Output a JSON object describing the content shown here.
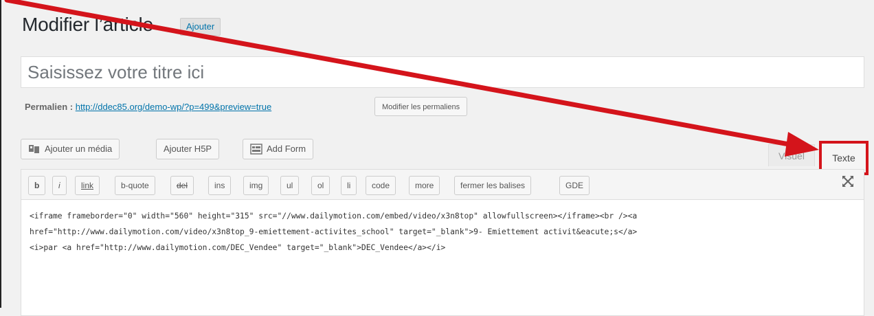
{
  "header": {
    "title": "Modifier l’article",
    "add_new_label": "Ajouter"
  },
  "post_title": {
    "placeholder": "Saisissez votre titre ici"
  },
  "permalink": {
    "label": "Permalien :",
    "url": "http://ddec85.org/demo-wp/?p=499&preview=true",
    "edit_button": "Modifier les permaliens"
  },
  "media_buttons": {
    "add_media": "Ajouter un média",
    "add_h5p": "Ajouter H5P",
    "add_form": "Add Form"
  },
  "editor_tabs": {
    "visual": "Visuel",
    "text": "Texte"
  },
  "quicktags": [
    "b",
    "i",
    "link",
    "b-quote",
    "del",
    "ins",
    "img",
    "ul",
    "ol",
    "li",
    "code",
    "more",
    "fermer les balises",
    "GDE"
  ],
  "editor": {
    "lines": [
      "<iframe frameborder=\"0\" width=\"560\" height=\"315\" src=\"//www.dailymotion.com/embed/video/x3n8top\" allowfullscreen></iframe><br /><a",
      "href=\"http://www.dailymotion.com/video/x3n8top_9-emiettement-activites_school\" target=\"_blank\">9- Emiettement activit&eacute;s</a>",
      "<i>par <a href=\"http://www.dailymotion.com/DEC_Vendee\" target=\"_blank\">DEC_Vendee</a></i>"
    ]
  },
  "annotation": {
    "color": "#d4141b"
  }
}
